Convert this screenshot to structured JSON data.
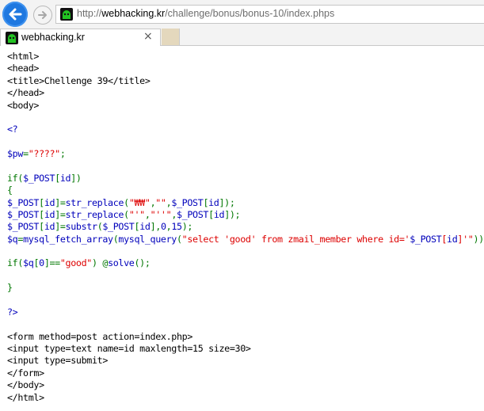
{
  "browser": {
    "url_prefix": "http://",
    "url_host": "webhacking.kr",
    "url_path": "/challenge/bonus/bonus-10/index.phps",
    "tab_title": "webhacking.kr",
    "tab_close_glyph": "×",
    "icons": [
      "back-arrow-icon",
      "forward-arrow-icon",
      "site-favicon",
      "close-icon"
    ],
    "colors": {
      "back_button": "#1f78e0",
      "new_tab": "#e4d8bd"
    }
  },
  "code": {
    "colors": {
      "html": "#000000",
      "php_default": "#0000bb",
      "php_keyword": "#007700",
      "php_string": "#dd0000"
    },
    "lines": [
      {
        "tokens": [
          {
            "t": "<html>",
            "c": "black"
          }
        ]
      },
      {
        "tokens": [
          {
            "t": "<head>",
            "c": "black"
          }
        ]
      },
      {
        "tokens": [
          {
            "t": "<title>Chellenge 39</title>",
            "c": "black"
          }
        ]
      },
      {
        "tokens": [
          {
            "t": "</head>",
            "c": "black"
          }
        ]
      },
      {
        "tokens": [
          {
            "t": "<body>",
            "c": "black"
          }
        ]
      },
      {
        "tokens": []
      },
      {
        "tokens": [
          {
            "t": "<?",
            "c": "blue"
          }
        ]
      },
      {
        "tokens": []
      },
      {
        "tokens": [
          {
            "t": "$pw",
            "c": "blue"
          },
          {
            "t": "=",
            "c": "green"
          },
          {
            "t": "\"????\"",
            "c": "red"
          },
          {
            "t": ";",
            "c": "green"
          }
        ]
      },
      {
        "tokens": []
      },
      {
        "tokens": [
          {
            "t": "if(",
            "c": "green"
          },
          {
            "t": "$_POST",
            "c": "blue"
          },
          {
            "t": "[",
            "c": "green"
          },
          {
            "t": "id",
            "c": "blue"
          },
          {
            "t": "])",
            "c": "green"
          }
        ]
      },
      {
        "tokens": [
          {
            "t": "{",
            "c": "green"
          }
        ]
      },
      {
        "tokens": [
          {
            "t": "$_POST",
            "c": "blue"
          },
          {
            "t": "[",
            "c": "green"
          },
          {
            "t": "id",
            "c": "blue"
          },
          {
            "t": "]=",
            "c": "green"
          },
          {
            "t": "str_replace",
            "c": "blue"
          },
          {
            "t": "(",
            "c": "green"
          },
          {
            "t": "\"₩₩\"",
            "c": "red"
          },
          {
            "t": ",",
            "c": "green"
          },
          {
            "t": "\"\"",
            "c": "red"
          },
          {
            "t": ",",
            "c": "green"
          },
          {
            "t": "$_POST",
            "c": "blue"
          },
          {
            "t": "[",
            "c": "green"
          },
          {
            "t": "id",
            "c": "blue"
          },
          {
            "t": "]);",
            "c": "green"
          }
        ]
      },
      {
        "tokens": [
          {
            "t": "$_POST",
            "c": "blue"
          },
          {
            "t": "[",
            "c": "green"
          },
          {
            "t": "id",
            "c": "blue"
          },
          {
            "t": "]=",
            "c": "green"
          },
          {
            "t": "str_replace",
            "c": "blue"
          },
          {
            "t": "(",
            "c": "green"
          },
          {
            "t": "\"'\"",
            "c": "red"
          },
          {
            "t": ",",
            "c": "green"
          },
          {
            "t": "\"''\"",
            "c": "red"
          },
          {
            "t": ",",
            "c": "green"
          },
          {
            "t": "$_POST",
            "c": "blue"
          },
          {
            "t": "[",
            "c": "green"
          },
          {
            "t": "id",
            "c": "blue"
          },
          {
            "t": "]);",
            "c": "green"
          }
        ]
      },
      {
        "tokens": [
          {
            "t": "$_POST",
            "c": "blue"
          },
          {
            "t": "[",
            "c": "green"
          },
          {
            "t": "id",
            "c": "blue"
          },
          {
            "t": "]=",
            "c": "green"
          },
          {
            "t": "substr",
            "c": "blue"
          },
          {
            "t": "(",
            "c": "green"
          },
          {
            "t": "$_POST",
            "c": "blue"
          },
          {
            "t": "[",
            "c": "green"
          },
          {
            "t": "id",
            "c": "blue"
          },
          {
            "t": "],",
            "c": "green"
          },
          {
            "t": "0",
            "c": "blue"
          },
          {
            "t": ",",
            "c": "green"
          },
          {
            "t": "15",
            "c": "blue"
          },
          {
            "t": ");",
            "c": "green"
          }
        ]
      },
      {
        "tokens": [
          {
            "t": "$q",
            "c": "blue"
          },
          {
            "t": "=",
            "c": "green"
          },
          {
            "t": "mysql_fetch_array",
            "c": "blue"
          },
          {
            "t": "(",
            "c": "green"
          },
          {
            "t": "mysql_query",
            "c": "blue"
          },
          {
            "t": "(",
            "c": "green"
          },
          {
            "t": "\"select 'good' from zmail_member where id='",
            "c": "red"
          },
          {
            "t": "$_POST",
            "c": "blue"
          },
          {
            "t": "[",
            "c": "red"
          },
          {
            "t": "id",
            "c": "blue"
          },
          {
            "t": "]",
            "c": "red"
          },
          {
            "t": "'\"",
            "c": "red"
          },
          {
            "t": "));",
            "c": "green"
          }
        ]
      },
      {
        "tokens": []
      },
      {
        "tokens": [
          {
            "t": "if(",
            "c": "green"
          },
          {
            "t": "$q",
            "c": "blue"
          },
          {
            "t": "[",
            "c": "green"
          },
          {
            "t": "0",
            "c": "blue"
          },
          {
            "t": "]==",
            "c": "green"
          },
          {
            "t": "\"good\"",
            "c": "red"
          },
          {
            "t": ") @",
            "c": "green"
          },
          {
            "t": "solve",
            "c": "blue"
          },
          {
            "t": "();",
            "c": "green"
          }
        ]
      },
      {
        "tokens": []
      },
      {
        "tokens": [
          {
            "t": "}",
            "c": "green"
          }
        ]
      },
      {
        "tokens": []
      },
      {
        "tokens": [
          {
            "t": "?>",
            "c": "blue"
          }
        ]
      },
      {
        "tokens": []
      },
      {
        "tokens": [
          {
            "t": "<form method=post action=index.php>",
            "c": "black"
          }
        ]
      },
      {
        "tokens": [
          {
            "t": "<input type=text name=id maxlength=15 size=30>",
            "c": "black"
          }
        ]
      },
      {
        "tokens": [
          {
            "t": "<input type=submit>",
            "c": "black"
          }
        ]
      },
      {
        "tokens": [
          {
            "t": "</form>",
            "c": "black"
          }
        ]
      },
      {
        "tokens": [
          {
            "t": "</body>",
            "c": "black"
          }
        ]
      },
      {
        "tokens": [
          {
            "t": "</html>",
            "c": "black"
          }
        ]
      }
    ]
  }
}
